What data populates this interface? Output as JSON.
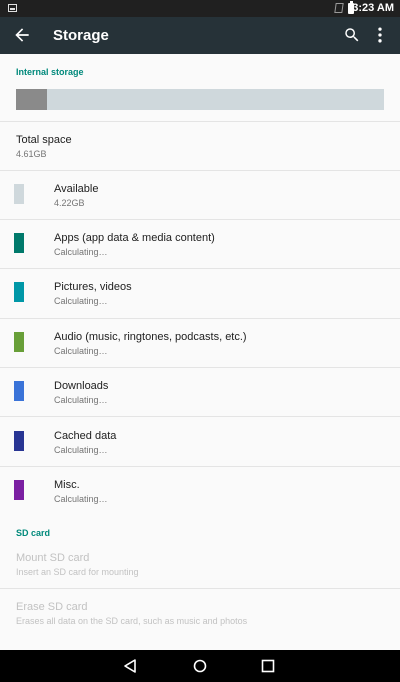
{
  "status_bar": {
    "time": "3:23 AM"
  },
  "app_bar": {
    "title": "Storage",
    "back_icon": "arrow-back-icon",
    "search_icon": "search-icon",
    "overflow_icon": "more-vert-icon"
  },
  "internal_storage": {
    "header": "Internal storage",
    "used_fraction": 0.085,
    "used_color": "#8a8a8a",
    "free_color": "#cfd8dc"
  },
  "total_space": {
    "title": "Total space",
    "value": "4.61GB"
  },
  "categories": [
    {
      "label": "Available",
      "value": "4.22GB",
      "color": "#cfd8dc"
    },
    {
      "label": "Apps (app data & media content)",
      "value": "Calculating…",
      "color": "#00796b"
    },
    {
      "label": "Pictures, videos",
      "value": "Calculating…",
      "color": "#0097a7"
    },
    {
      "label": "Audio (music, ringtones, podcasts, etc.)",
      "value": "Calculating…",
      "color": "#689f38"
    },
    {
      "label": "Downloads",
      "value": "Calculating…",
      "color": "#3a73d8"
    },
    {
      "label": "Cached data",
      "value": "Calculating…",
      "color": "#283593"
    },
    {
      "label": "Misc.",
      "value": "Calculating…",
      "color": "#7b1fa2"
    }
  ],
  "sd_card": {
    "header": "SD card",
    "mount": {
      "title": "Mount SD card",
      "summary": "Insert an SD card for mounting"
    },
    "erase": {
      "title": "Erase SD card",
      "summary": "Erases all data on the SD card, such as music and photos"
    }
  },
  "nav_bar": {
    "back": "nav-back-icon",
    "home": "nav-home-icon",
    "recents": "nav-recents-icon"
  },
  "colors": {
    "accent": "#00897b",
    "app_bar": "#263238",
    "status_bar": "#202020"
  }
}
